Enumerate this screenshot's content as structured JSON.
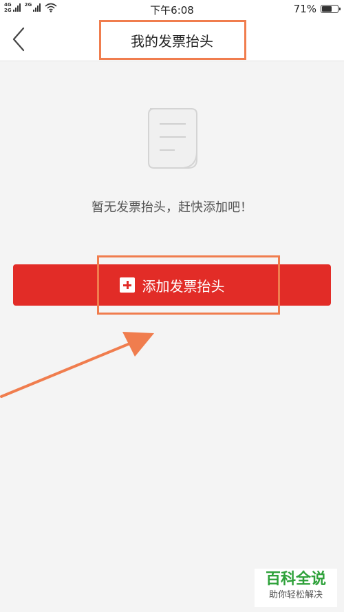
{
  "status_bar": {
    "network_top": "4G",
    "network_bottom": "2G",
    "network2": "2G",
    "time": "下午6:08",
    "battery_text": "71%",
    "battery_level": 0.71
  },
  "header": {
    "title": "我的发票抬头"
  },
  "empty_state": {
    "icon": "document-icon",
    "message": "暂无发票抬头，赶快添加吧！"
  },
  "actions": {
    "add_label": "添加发票抬头",
    "add_icon": "plus-square-icon"
  },
  "watermark": {
    "main": "百科全说",
    "sub": "助你轻松解决"
  },
  "colors": {
    "accent": "#e22c27",
    "annotation": "#f07d4e",
    "background": "#f4f4f4",
    "watermark_green": "#2ea13a"
  }
}
